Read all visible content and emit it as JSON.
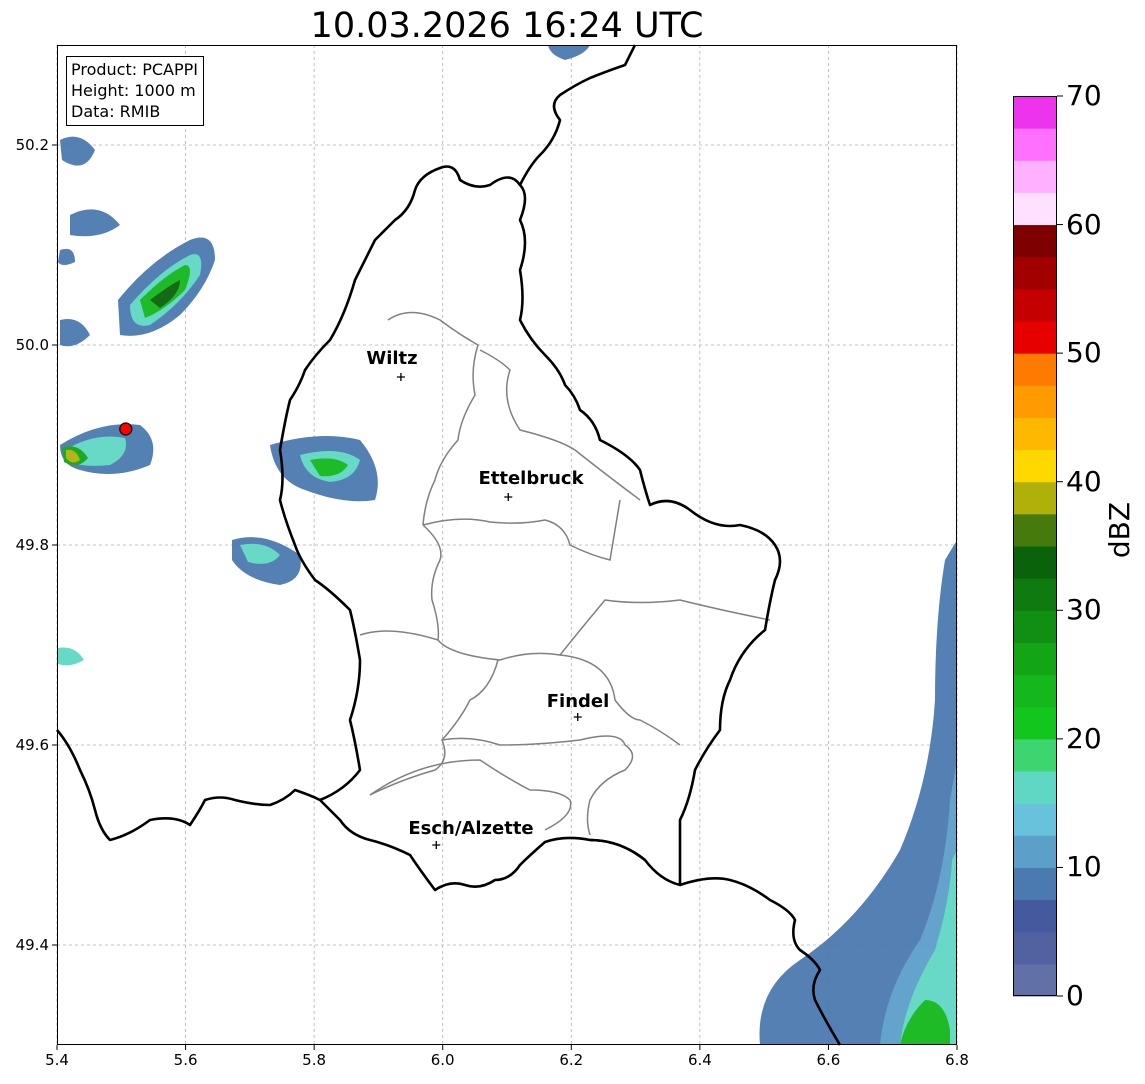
{
  "title": "10.03.2026 16:24 UTC",
  "info_box": {
    "product": "Product: PCAPPI",
    "height": "Height: 1000 m",
    "data": "Data: RMIB"
  },
  "axes": {
    "x_ticks": [
      "5.4",
      "5.6",
      "5.8",
      "6.0",
      "6.2",
      "6.4",
      "6.6",
      "6.8"
    ],
    "y_ticks": [
      "50.2",
      "50.0",
      "49.8",
      "49.6",
      "49.4"
    ],
    "x_range": [
      5.4,
      6.8
    ],
    "y_range": [
      49.3,
      50.3
    ],
    "grid": true
  },
  "colorbar": {
    "label": "dBZ",
    "ticks": [
      "70",
      "60",
      "50",
      "40",
      "30",
      "20",
      "10",
      "0"
    ],
    "range": [
      0,
      70
    ],
    "colors": [
      "#6170a6",
      "#5262a0",
      "#45599f",
      "#4b7ab0",
      "#5c9fc9",
      "#68c2dc",
      "#5fd7c4",
      "#3dd570",
      "#12c61e",
      "#14b81c",
      "#12a516",
      "#108f12",
      "#0e7a10",
      "#0a620b",
      "#467a0c",
      "#b0b00a",
      "#ffd800",
      "#ffb800",
      "#ff9a00",
      "#ff7a00",
      "#e60000",
      "#c40000",
      "#a20000",
      "#7e0000",
      "#ffe0ff",
      "#ffb0ff",
      "#ff70ff",
      "#ee33ee"
    ]
  },
  "cities": [
    {
      "name": "Wiltz",
      "lon": 5.935,
      "lat": 49.968
    },
    {
      "name": "Ettelbruck",
      "lon": 6.102,
      "lat": 49.848
    },
    {
      "name": "Findel",
      "lon": 6.21,
      "lat": 49.628
    },
    {
      "name": "Esch/Alzette",
      "lon": 5.99,
      "lat": 49.5
    }
  ],
  "radar_marker": {
    "lon": 5.507,
    "lat": 49.916,
    "color": "#ff0000"
  }
}
